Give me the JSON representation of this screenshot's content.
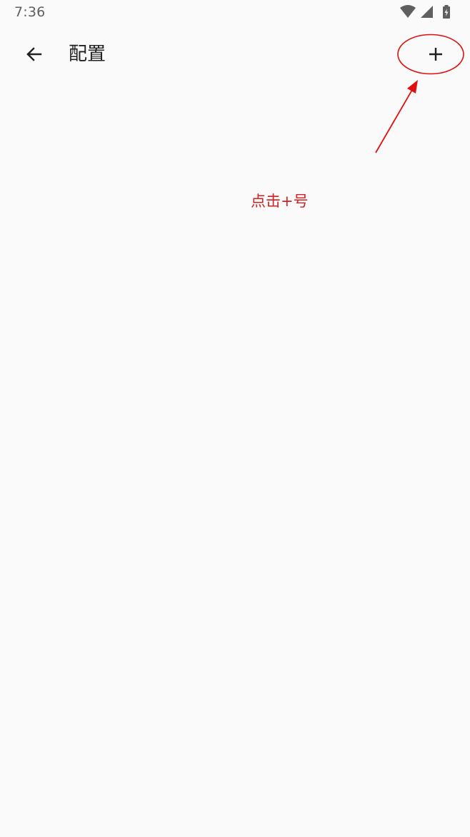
{
  "status_bar": {
    "time": "7:36",
    "icons": [
      "wifi-icon",
      "signal-icon",
      "battery-charging-icon"
    ]
  },
  "app_bar": {
    "back_icon": "arrow-back-icon",
    "title": "配置",
    "add_icon": "plus-icon"
  },
  "annotation": {
    "text": "点击+号",
    "color": "#e01010"
  },
  "colors": {
    "background": "#fafafa",
    "title": "#212121",
    "status_text": "#5f5f5f",
    "annotation": "#e01010"
  }
}
